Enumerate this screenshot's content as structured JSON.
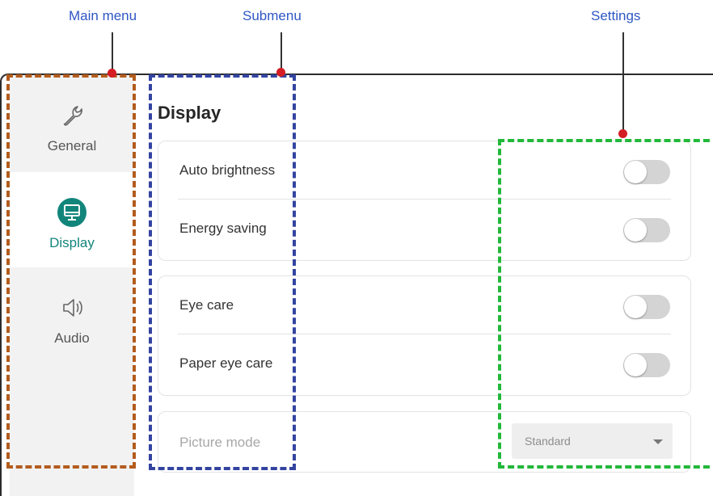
{
  "annotations": {
    "main_menu": "Main menu",
    "submenu": "Submenu",
    "settings": "Settings"
  },
  "sidebar": {
    "items": [
      {
        "label": "General",
        "icon": "wrench-icon",
        "active": false
      },
      {
        "label": "Display",
        "icon": "monitor-icon",
        "active": true
      },
      {
        "label": "Audio",
        "icon": "speaker-icon",
        "active": false
      }
    ]
  },
  "page": {
    "title": "Display"
  },
  "settings": {
    "auto_brightness": {
      "label": "Auto brightness",
      "on": false
    },
    "energy_saving": {
      "label": "Energy saving",
      "on": false
    },
    "eye_care": {
      "label": "Eye care",
      "on": false
    },
    "paper_eye_care": {
      "label": "Paper eye care",
      "on": false
    },
    "picture_mode": {
      "label": "Picture mode",
      "value": "Standard",
      "enabled": false
    }
  },
  "colors": {
    "accent": "#12857b",
    "main_menu_box": "#b35c1e",
    "submenu_box": "#3344a0",
    "settings_box": "#22b83a",
    "annotation_text": "#2f57c4",
    "marker": "#d41d24"
  }
}
